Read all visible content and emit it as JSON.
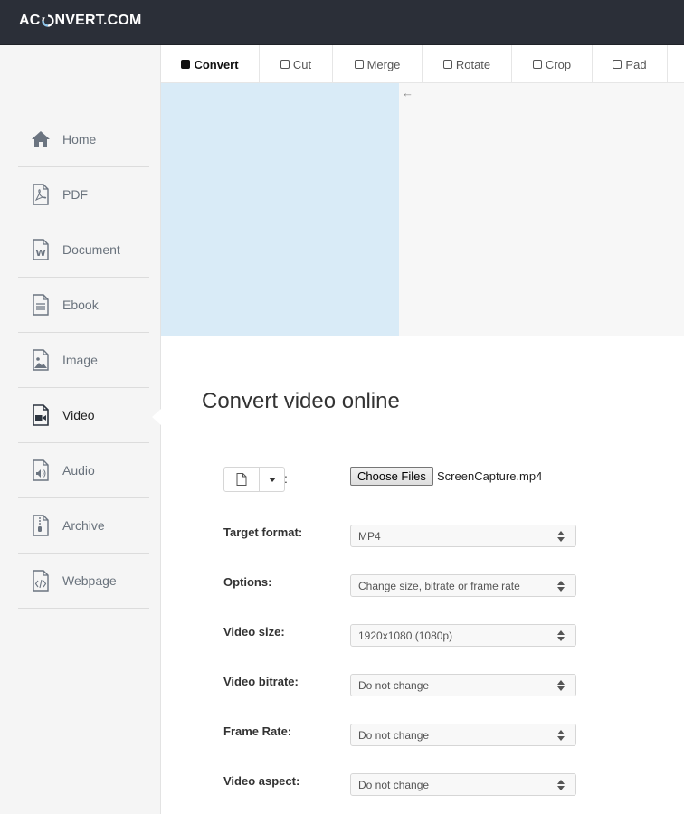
{
  "header": {
    "logo_left": "AC",
    "logo_right": "NVERT.COM"
  },
  "sidebar": {
    "items": [
      {
        "label": "Home",
        "icon": "home-icon"
      },
      {
        "label": "PDF",
        "icon": "pdf-file-icon"
      },
      {
        "label": "Document",
        "icon": "word-document-icon"
      },
      {
        "label": "Ebook",
        "icon": "ebook-icon"
      },
      {
        "label": "Image",
        "icon": "image-icon"
      },
      {
        "label": "Video",
        "icon": "video-icon",
        "active": true
      },
      {
        "label": "Audio",
        "icon": "audio-file-icon"
      },
      {
        "label": "Archive",
        "icon": "archive-icon"
      },
      {
        "label": "Webpage",
        "icon": "webpage-icon"
      }
    ]
  },
  "tabs": [
    {
      "label": "Convert",
      "active": true
    },
    {
      "label": "Cut"
    },
    {
      "label": "Merge"
    },
    {
      "label": "Rotate"
    },
    {
      "label": "Crop"
    },
    {
      "label": "Pad"
    }
  ],
  "main": {
    "title": "Convert video online",
    "file": {
      "colon": ":",
      "choose_label": "Choose Files",
      "file_name": "ScreenCapture.mp4"
    },
    "fields": [
      {
        "label": "Target format:",
        "value": "MP4"
      },
      {
        "label": "Options:",
        "value": "Change size, bitrate or frame rate"
      },
      {
        "label": "Video size:",
        "value": "1920x1080 (1080p)"
      },
      {
        "label": "Video bitrate:",
        "value": "Do not change"
      },
      {
        "label": "Frame Rate:",
        "value": "Do not change"
      },
      {
        "label": "Video aspect:",
        "value": "Do not change"
      }
    ]
  },
  "ad": {
    "arrow": "←"
  },
  "colors": {
    "topbar": "#2b2f38",
    "sidebar_bg": "#f5f5f5",
    "ad_blue": "#d9ebf7"
  }
}
